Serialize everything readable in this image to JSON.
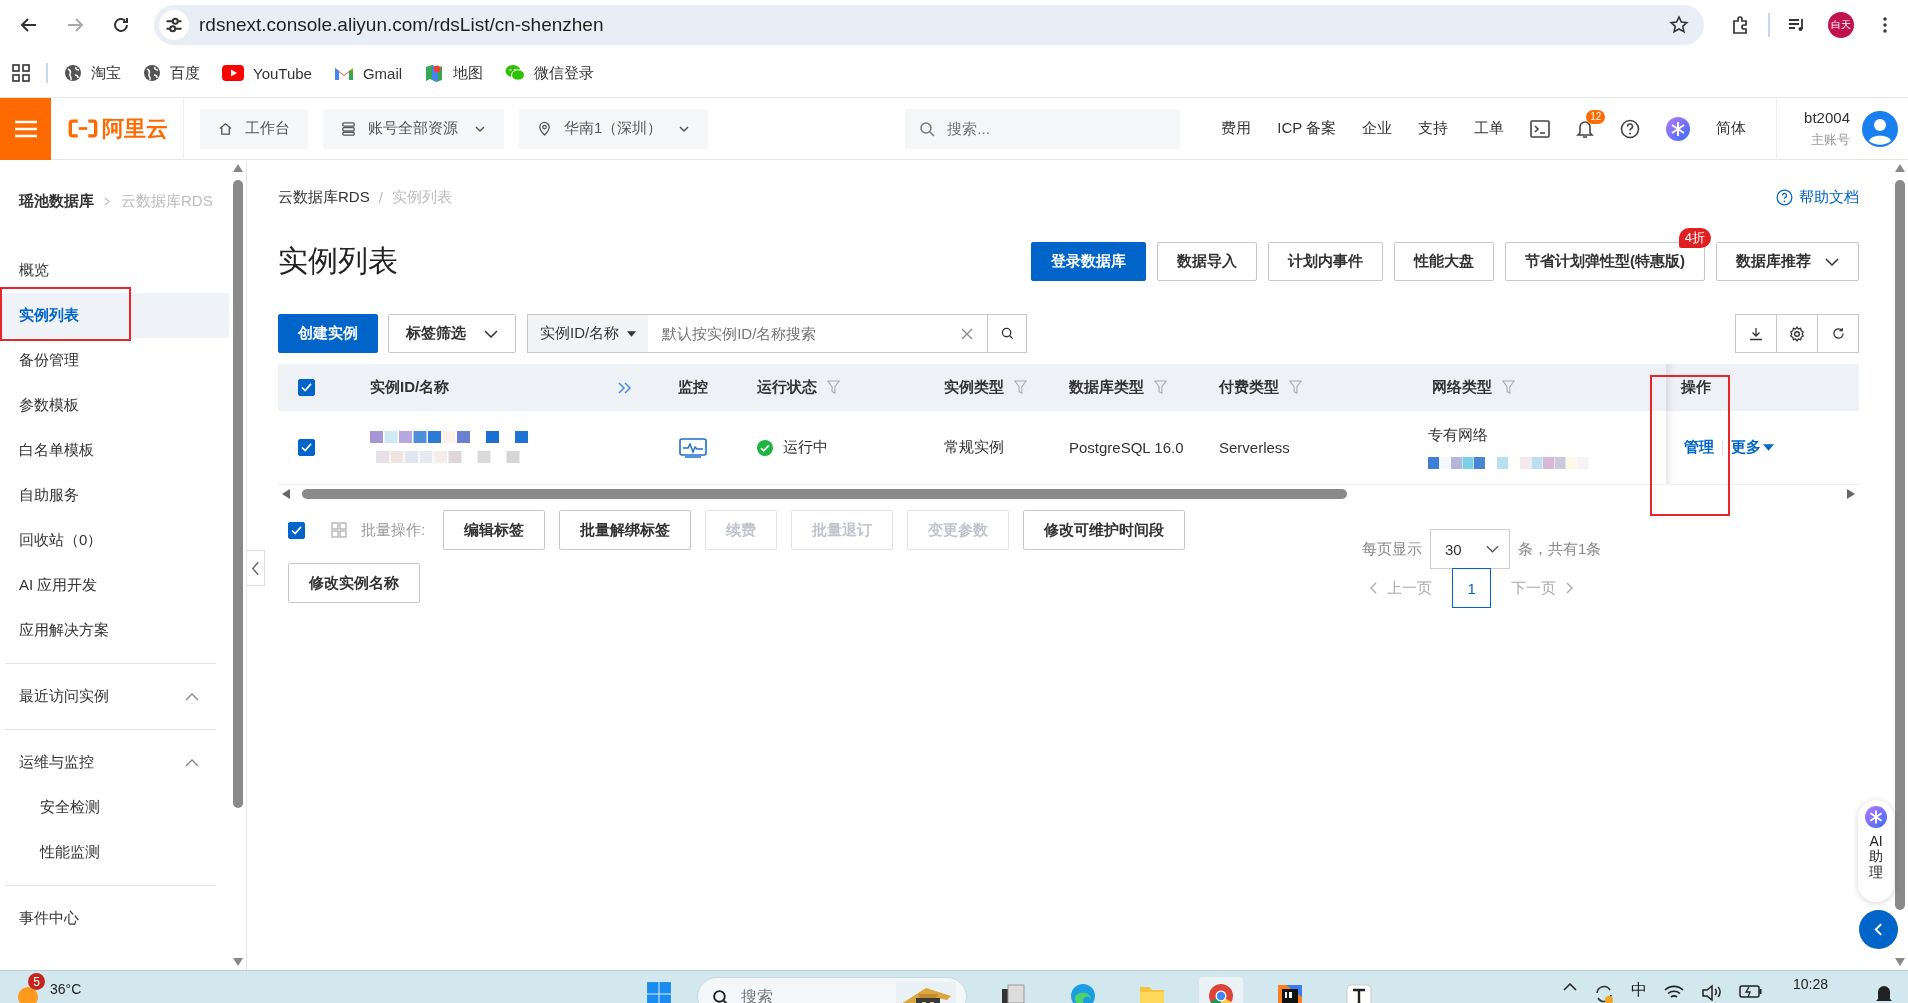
{
  "browser": {
    "url": "rdsnext.console.aliyun.com/rdsList/cn-shenzhen",
    "profile": "白天",
    "bookmarks": [
      {
        "label": "淘宝",
        "kind": "globe"
      },
      {
        "label": "百度",
        "kind": "globe"
      },
      {
        "label": "YouTube",
        "kind": "youtube"
      },
      {
        "label": "Gmail",
        "kind": "gmail"
      },
      {
        "label": "地图",
        "kind": "maps"
      },
      {
        "label": "微信登录",
        "kind": "wechat"
      }
    ]
  },
  "console_header": {
    "logo": "阿里云",
    "pills": [
      {
        "label": "工作台",
        "kind": "home"
      },
      {
        "label": "账号全部资源",
        "kind": "resources"
      },
      {
        "label": "华南1（深圳）",
        "kind": "region"
      }
    ],
    "search": {
      "placeholder": "搜索..."
    },
    "links": [
      "费用",
      "ICP 备案",
      "企业",
      "支持",
      "工单"
    ],
    "notifications": "12",
    "language": "简体",
    "user": {
      "name": "bt2004",
      "role": "主账号"
    }
  },
  "sidebar": {
    "breadcrumb": [
      "瑶池数据库",
      "云数据库RDS"
    ],
    "items": [
      {
        "label": "概览",
        "selected": false
      },
      {
        "label": "实例列表",
        "selected": true,
        "highlighted": true
      },
      {
        "label": "备份管理",
        "selected": false
      },
      {
        "label": "参数模板",
        "selected": false
      },
      {
        "label": "白名单模板",
        "selected": false
      },
      {
        "label": "自助服务",
        "selected": false
      },
      {
        "label": "回收站（0）",
        "selected": false
      },
      {
        "label": "AI 应用开发",
        "selected": false
      },
      {
        "label": "应用解决方案",
        "selected": false
      }
    ],
    "groups": [
      {
        "label": "最近访问实例",
        "expanded": true
      },
      {
        "label": "运维与监控",
        "expanded": true,
        "children": [
          {
            "label": "安全检测"
          },
          {
            "label": "性能监测"
          }
        ]
      }
    ],
    "footer_items": [
      "事件中心"
    ]
  },
  "page": {
    "breadcrumb": [
      "云数据库RDS",
      "实例列表"
    ],
    "separator": "/",
    "help_link": "帮助文档",
    "title": "实例列表",
    "actions": [
      {
        "label": "登录数据库",
        "primary": true
      },
      {
        "label": "数据导入",
        "primary": false
      },
      {
        "label": "计划内事件",
        "primary": false
      },
      {
        "label": "性能大盘",
        "primary": false
      },
      {
        "label": "节省计划弹性型(特惠版)",
        "primary": false,
        "badge": "4折"
      },
      {
        "label": "数据库推荐",
        "primary": false,
        "dropdown": true
      }
    ],
    "toolbar": {
      "create": "创建实例",
      "tag_filter": "标签筛选",
      "search_scope": "实例ID/名称",
      "search": {
        "placeholder": "默认按实例ID/名称搜索"
      }
    },
    "table": {
      "columns": [
        {
          "kind": "checkbox",
          "checked": true
        },
        {
          "label": "实例ID/名称",
          "kind": "expand"
        },
        {
          "label": "监控",
          "kind": "plain"
        },
        {
          "label": "运行状态",
          "kind": "filter"
        },
        {
          "label": "实例类型",
          "kind": "filter"
        },
        {
          "label": "数据库类型",
          "kind": "filter"
        },
        {
          "label": "付费类型",
          "kind": "filter"
        },
        {
          "label": "网络类型",
          "kind": "filter"
        },
        {
          "label": "操作",
          "kind": "plain",
          "highlighted": true
        }
      ],
      "rows": [
        {
          "checked": true,
          "status": "运行中",
          "instance_type": "常规实例",
          "db_type": "PostgreSQL 16.0",
          "billing": "Serverless",
          "network": "专有网络",
          "actions": [
            {
              "label": "管理",
              "kind": "link"
            },
            {
              "label": "更多",
              "kind": "menu"
            }
          ]
        }
      ]
    },
    "batch": {
      "checked": true,
      "label": "批量操作:",
      "buttons": [
        {
          "label": "编辑标签",
          "disabled": false
        },
        {
          "label": "批量解绑标签",
          "disabled": false
        },
        {
          "label": "续费",
          "disabled": true
        },
        {
          "label": "批量退订",
          "disabled": true
        },
        {
          "label": "变更参数",
          "disabled": true
        },
        {
          "label": "修改可维护时间段",
          "disabled": false
        },
        {
          "label": "修改实例名称",
          "disabled": false
        }
      ]
    },
    "pagination": {
      "per_page_label": "每页显示",
      "page_size": "30",
      "total": "条，共有1条",
      "prev": "上一页",
      "next": "下一页",
      "prev_disabled": true,
      "next_disabled": true,
      "pages": [
        {
          "label": "1",
          "selected": true
        }
      ]
    }
  },
  "ai_assistant": {
    "label": "AI 助理"
  },
  "taskbar": {
    "weather": {
      "temp": "36°C",
      "badge": "5"
    },
    "search": {
      "placeholder": "搜索"
    },
    "apps": [
      {
        "kind": "stack",
        "active": false
      },
      {
        "kind": "edge",
        "active": false
      },
      {
        "kind": "folder",
        "active": false
      },
      {
        "kind": "chrome",
        "active": true
      },
      {
        "kind": "intellij",
        "active": false
      },
      {
        "kind": "typora",
        "active": false
      }
    ],
    "ime": "中",
    "time": "10:28"
  }
}
